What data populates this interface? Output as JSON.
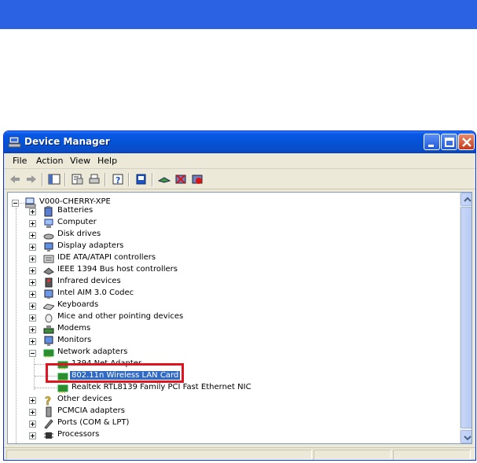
{
  "window": {
    "title": "Device Manager",
    "icon": "device-manager-icon"
  },
  "menu": [
    {
      "label": "File"
    },
    {
      "label": "Action"
    },
    {
      "label": "View"
    },
    {
      "label": "Help"
    }
  ],
  "toolbar": [
    {
      "icon": "back-arrow-icon"
    },
    {
      "icon": "forward-arrow-icon"
    },
    {
      "icon": "show-hide-console-tree-icon"
    },
    {
      "icon": "properties-icon"
    },
    {
      "icon": "print-icon"
    },
    {
      "icon": "help-icon"
    },
    {
      "icon": "scan-hardware-changes-icon"
    },
    {
      "icon": "update-driver-icon"
    },
    {
      "icon": "uninstall-icon"
    },
    {
      "icon": "disable-device-icon"
    }
  ],
  "tree": {
    "root": "V000-CHERRY-XPE",
    "items": [
      {
        "label": "Batteries",
        "icon": "battery-icon",
        "expanded": false
      },
      {
        "label": "Computer",
        "icon": "computer-icon",
        "expanded": false
      },
      {
        "label": "Disk drives",
        "icon": "disk-drive-icon",
        "expanded": false
      },
      {
        "label": "Display adapters",
        "icon": "display-adapter-icon",
        "expanded": false
      },
      {
        "label": "IDE ATA/ATAPI controllers",
        "icon": "ide-controller-icon",
        "expanded": false
      },
      {
        "label": "IEEE 1394 Bus host controllers",
        "icon": "ieee1394-icon",
        "expanded": false
      },
      {
        "label": "Infrared devices",
        "icon": "infrared-icon",
        "expanded": false
      },
      {
        "label": "Intel AIM 3.0 Codec",
        "icon": "codec-icon",
        "expanded": false
      },
      {
        "label": "Keyboards",
        "icon": "keyboard-icon",
        "expanded": false
      },
      {
        "label": "Mice and other pointing devices",
        "icon": "mouse-icon",
        "expanded": false
      },
      {
        "label": "Modems",
        "icon": "modem-icon",
        "expanded": false
      },
      {
        "label": "Monitors",
        "icon": "monitor-icon",
        "expanded": false
      },
      {
        "label": "Network adapters",
        "icon": "network-adapter-icon",
        "expanded": true,
        "children": [
          {
            "label": "1394 Net Adapter",
            "icon": "network-card-icon"
          },
          {
            "label": "802.11n Wireless LAN Card",
            "icon": "network-card-icon",
            "selected": true
          },
          {
            "label": "Realtek RTL8139 Family PCI Fast Ethernet NIC",
            "icon": "network-card-icon"
          }
        ]
      },
      {
        "label": "Other devices",
        "icon": "unknown-device-icon",
        "expanded": false
      },
      {
        "label": "PCMCIA adapters",
        "icon": "pcmcia-icon",
        "expanded": false
      },
      {
        "label": "Ports (COM & LPT)",
        "icon": "port-icon",
        "expanded": false
      },
      {
        "label": "Processors",
        "icon": "processor-icon",
        "expanded": false
      }
    ]
  },
  "colors": {
    "banner": "#2b62e3",
    "selection": "#316ac5",
    "highlight_box": "#e0141e"
  }
}
